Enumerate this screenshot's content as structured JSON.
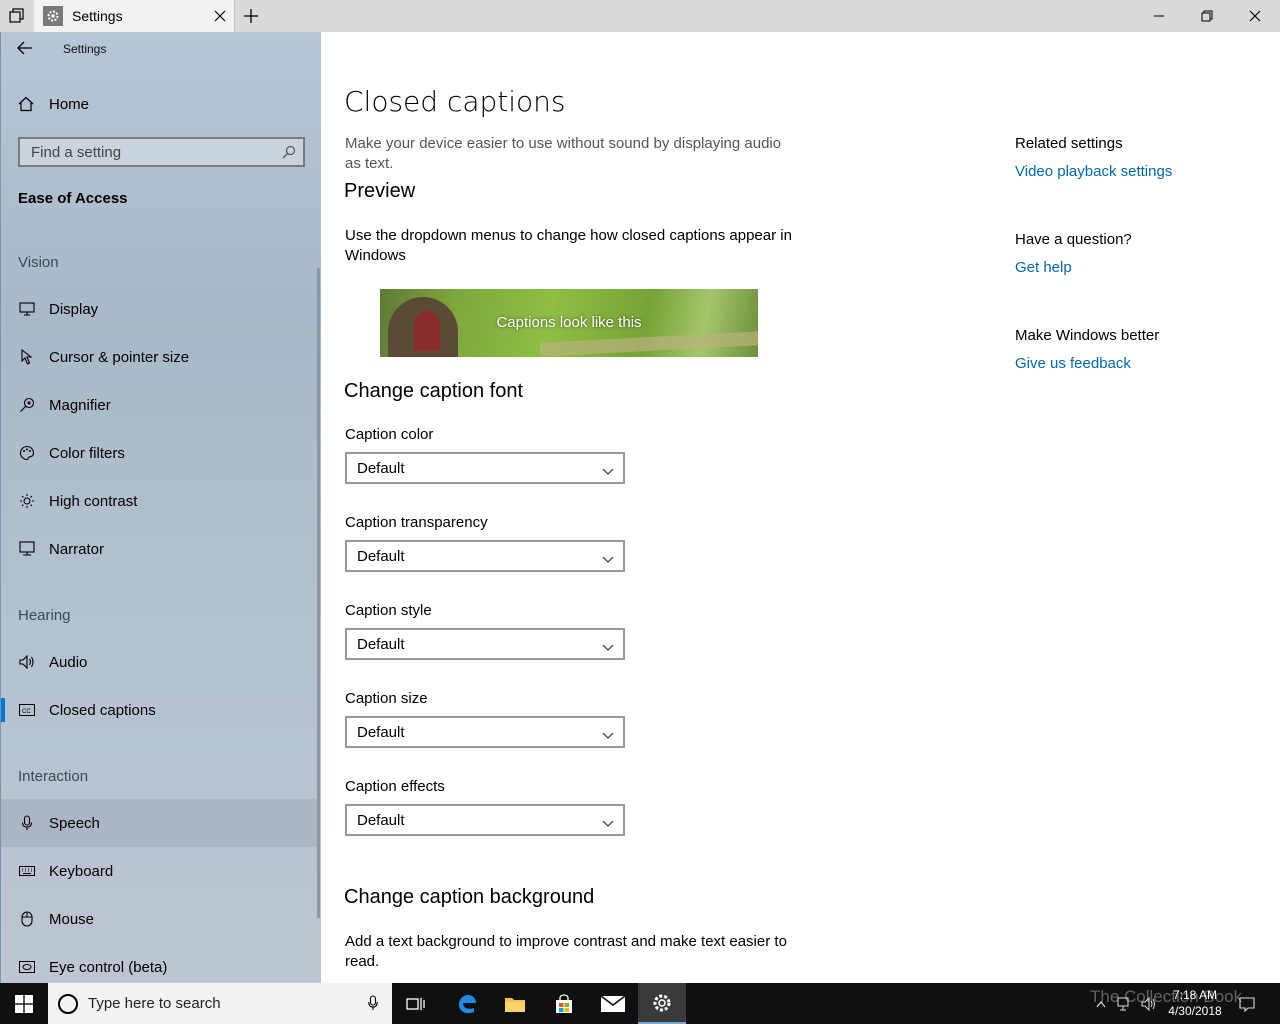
{
  "window": {
    "tab_title": "Settings",
    "minimize_icon": "minimize-icon",
    "restore_icon": "restore-icon",
    "close_icon": "close-icon"
  },
  "sidebar": {
    "header": "Settings",
    "home_label": "Home",
    "search_placeholder": "Find a setting",
    "section_title": "Ease of Access",
    "groups": {
      "vision": "Vision",
      "hearing": "Hearing",
      "interaction": "Interaction"
    },
    "items": {
      "display": "Display",
      "cursor": "Cursor & pointer size",
      "magnifier": "Magnifier",
      "color_filters": "Color filters",
      "high_contrast": "High contrast",
      "narrator": "Narrator",
      "audio": "Audio",
      "closed_captions": "Closed captions",
      "speech": "Speech",
      "keyboard": "Keyboard",
      "mouse": "Mouse",
      "eye_control": "Eye control (beta)"
    },
    "selected": "closed_captions",
    "accent_color": "#0078d7"
  },
  "main": {
    "title": "Closed captions",
    "subtitle": "Make your device easier to use without sound by displaying audio as text.",
    "preview_heading": "Preview",
    "preview_desc": "Use the dropdown menus to change how closed captions appear in Windows",
    "preview_caption": "Captions look like this",
    "font_heading": "Change caption font",
    "fields": {
      "color": {
        "label": "Caption color",
        "value": "Default"
      },
      "transparency": {
        "label": "Caption transparency",
        "value": "Default"
      },
      "style": {
        "label": "Caption style",
        "value": "Default"
      },
      "size": {
        "label": "Caption size",
        "value": "Default"
      },
      "effects": {
        "label": "Caption effects",
        "value": "Default"
      }
    },
    "background_heading": "Change caption background",
    "background_desc": "Add a text background to improve contrast and make text easier to read."
  },
  "related": {
    "related_heading": "Related settings",
    "video_link": "Video playback settings",
    "question_heading": "Have a question?",
    "help_link": "Get help",
    "better_heading": "Make Windows better",
    "feedback_link": "Give us feedback",
    "link_color": "#0067b8"
  },
  "taskbar": {
    "search_placeholder": "Type here to search",
    "time": "7:18 AM",
    "date": "4/30/2018",
    "watermark": "The Collection Book"
  }
}
